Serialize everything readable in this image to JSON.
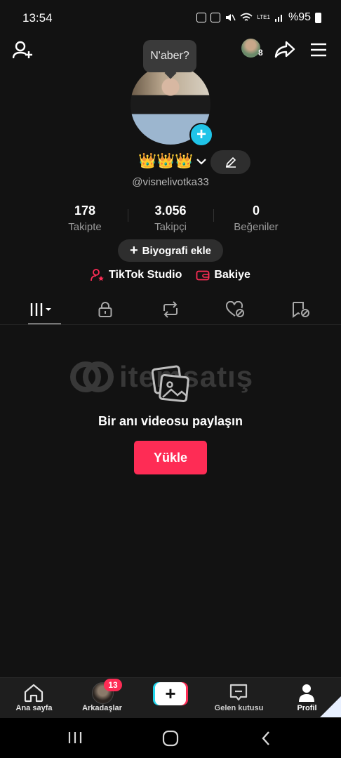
{
  "status_bar": {
    "time": "13:54",
    "battery": "%95",
    "network": "LTE1"
  },
  "top_bar": {
    "speech_bubble": "N'aber?",
    "friends_count": "8"
  },
  "profile": {
    "name_emoji": "👑👑👑",
    "username": "@visnelivotka33",
    "stats": [
      {
        "value": "178",
        "label": "Takipte"
      },
      {
        "value": "3.056",
        "label": "Takipçi"
      },
      {
        "value": "0",
        "label": "Beğeniler"
      }
    ],
    "bio_button": "Biyografi ekle",
    "studio_link": "TikTok Studio",
    "balance_link": "Bakiye"
  },
  "tabs": [
    "videos-grid",
    "private",
    "reposts",
    "liked",
    "favorites"
  ],
  "watermark": {
    "text": "itemsatış"
  },
  "empty_state": {
    "title": "Bir anı videosu paylaşın",
    "button": "Yükle"
  },
  "bottom_nav": {
    "home": "Ana sayfa",
    "friends": "Arkadaşlar",
    "friends_badge": "13",
    "inbox": "Gelen kutusu",
    "profile": "Profil"
  },
  "colors": {
    "accent": "#fe2c55",
    "cyan": "#20d5ec",
    "background": "#121212"
  }
}
